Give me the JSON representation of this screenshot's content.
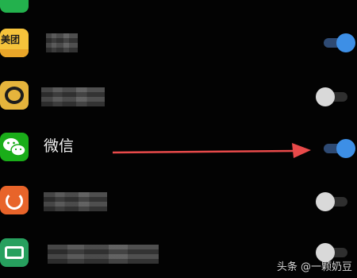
{
  "settings": {
    "rows": [
      {
        "name": "",
        "icon": "green-app-icon",
        "toggle": "hidden"
      },
      {
        "name": "",
        "icon": "meituan-app-icon",
        "icon_text": "美团",
        "toggle": "on"
      },
      {
        "name": "",
        "icon": "yellow-app-icon",
        "toggle": "off"
      },
      {
        "name": "微信",
        "icon": "wechat-icon",
        "toggle": "on"
      },
      {
        "name": "",
        "icon": "orange-app-icon",
        "toggle": "off"
      },
      {
        "name": "",
        "icon": "green-outline-app-icon",
        "toggle": "off"
      }
    ]
  },
  "watermark": {
    "text": "头条 @一颗奶豆"
  },
  "colors": {
    "toggle_on": "#3d8fe6",
    "toggle_off": "#d9d9d9",
    "arrow": "#e84a4a",
    "wechat_green": "#1aad19"
  }
}
